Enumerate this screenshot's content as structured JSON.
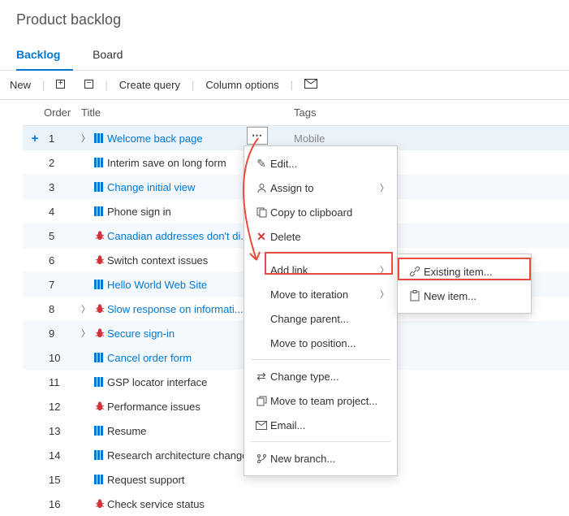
{
  "page_title": "Product backlog",
  "tabs": [
    {
      "label": "Backlog",
      "active": true
    },
    {
      "label": "Board",
      "active": false
    }
  ],
  "toolbar": {
    "new_label": "New",
    "create_query": "Create query",
    "column_options": "Column options"
  },
  "columns": {
    "order": "Order",
    "title": "Title",
    "tags": "Tags"
  },
  "rows": [
    {
      "order": 1,
      "title": "Welcome back page",
      "type": "pbi",
      "link": true,
      "chev": true,
      "tags": "Mobile",
      "first": true
    },
    {
      "order": 2,
      "title": "Interim save on long form",
      "type": "pbi",
      "link": false
    },
    {
      "order": 3,
      "title": "Change initial view",
      "type": "pbi",
      "link": true,
      "stripe": true
    },
    {
      "order": 4,
      "title": "Phone sign in",
      "type": "pbi",
      "link": false
    },
    {
      "order": 5,
      "title": "Canadian addresses don't di...",
      "type": "bug",
      "link": true,
      "stripe": true
    },
    {
      "order": 6,
      "title": "Switch context issues",
      "type": "bug",
      "link": false
    },
    {
      "order": 7,
      "title": "Hello World Web Site",
      "type": "pbi",
      "link": true,
      "stripe": true
    },
    {
      "order": 8,
      "title": "Slow response on informati...",
      "type": "bug",
      "link": true,
      "chev": true
    },
    {
      "order": 9,
      "title": "Secure sign-in",
      "type": "bug",
      "link": true,
      "chev": true,
      "stripe": true
    },
    {
      "order": 10,
      "title": "Cancel order form",
      "type": "pbi",
      "link": true,
      "stripe": true
    },
    {
      "order": 11,
      "title": "GSP locator interface",
      "type": "pbi",
      "link": false
    },
    {
      "order": 12,
      "title": "Performance issues",
      "type": "bug",
      "link": false
    },
    {
      "order": 13,
      "title": "Resume",
      "type": "pbi",
      "link": false
    },
    {
      "order": 14,
      "title": "Research architecture changes",
      "type": "pbi",
      "link": false
    },
    {
      "order": 15,
      "title": "Request support",
      "type": "pbi",
      "link": false
    },
    {
      "order": 16,
      "title": "Check service status",
      "type": "bug",
      "link": false
    }
  ],
  "context_menu": {
    "edit": "Edit...",
    "assign_to": "Assign to",
    "copy": "Copy to clipboard",
    "delete": "Delete",
    "add_link": "Add link",
    "move_iteration": "Move to iteration",
    "change_parent": "Change parent...",
    "move_position": "Move to position...",
    "change_type": "Change type...",
    "move_team": "Move to team project...",
    "email": "Email...",
    "new_branch": "New branch..."
  },
  "submenu": {
    "existing": "Existing item...",
    "new_item": "New item..."
  }
}
